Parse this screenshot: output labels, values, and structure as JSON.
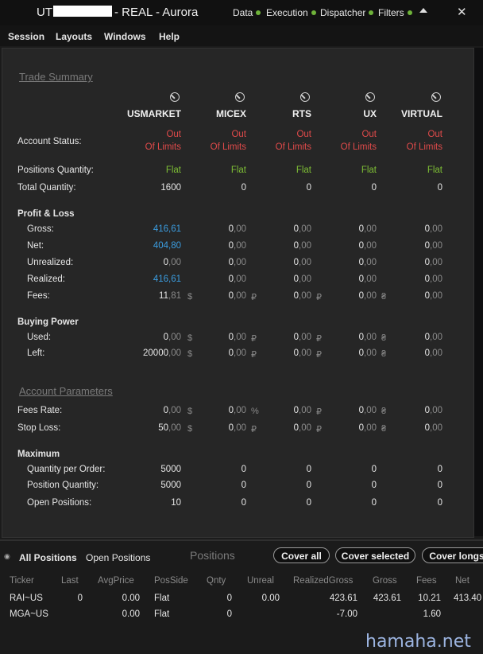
{
  "window": {
    "title_prefix": "UT",
    "title_suffix": "- REAL - Aurora",
    "nav": [
      "Data",
      "Execution",
      "Dispatcher",
      "Filters"
    ],
    "close_glyph": "✕"
  },
  "menu": [
    "Session",
    "Layouts",
    "Windows",
    "Help"
  ],
  "trade_summary": {
    "section_title": "Trade Summary",
    "columns": [
      "USMARKET",
      "MICEX",
      "RTS",
      "UX",
      "VIRTUAL"
    ],
    "labels": {
      "account_status": "Account Status:",
      "positions_quantity": "Positions Quantity:",
      "total_quantity": "Total Quantity:",
      "profit_loss": "Profit & Loss",
      "gross": "Gross:",
      "net": "Net:",
      "unrealized": "Unrealized:",
      "realized": "Realized:",
      "fees": "Fees:",
      "buying_power": "Buying Power",
      "used": "Used:",
      "left": "Left:"
    },
    "account_status": [
      [
        "Out",
        "Of Limits"
      ],
      [
        "Out",
        "Of Limits"
      ],
      [
        "Out",
        "Of Limits"
      ],
      [
        "Out",
        "Of Limits"
      ],
      [
        "Out",
        "Of Limits"
      ]
    ],
    "positions_quantity": [
      "Flat",
      "Flat",
      "Flat",
      "Flat",
      "Flat"
    ],
    "total_quantity": [
      "1600",
      "0",
      "0",
      "0",
      "0"
    ],
    "gross": [
      [
        "416",
        ",61"
      ],
      [
        "0",
        ",00"
      ],
      [
        "0",
        ",00"
      ],
      [
        "0",
        ",00"
      ],
      [
        "0",
        ",00"
      ]
    ],
    "net": [
      [
        "404",
        ",80"
      ],
      [
        "0",
        ",00"
      ],
      [
        "0",
        ",00"
      ],
      [
        "0",
        ",00"
      ],
      [
        "0",
        ",00"
      ]
    ],
    "unrealized": [
      [
        "0",
        ",00"
      ],
      [
        "0",
        ",00"
      ],
      [
        "0",
        ",00"
      ],
      [
        "0",
        ",00"
      ],
      [
        "0",
        ",00"
      ]
    ],
    "realized": [
      [
        "416",
        ",61"
      ],
      [
        "0",
        ",00"
      ],
      [
        "0",
        ",00"
      ],
      [
        "0",
        ",00"
      ],
      [
        "0",
        ",00"
      ]
    ],
    "fees": [
      [
        "11",
        ",81"
      ],
      [
        "0",
        ",00"
      ],
      [
        "0",
        ",00"
      ],
      [
        "0",
        ",00"
      ],
      [
        "0",
        ",00"
      ]
    ],
    "used": [
      [
        "0",
        ",00"
      ],
      [
        "0",
        ",00"
      ],
      [
        "0",
        ",00"
      ],
      [
        "0",
        ",00"
      ],
      [
        "0",
        ",00"
      ]
    ],
    "left": [
      [
        "20000",
        ",00"
      ],
      [
        "0",
        ",00"
      ],
      [
        "0",
        ",00"
      ],
      [
        "0",
        ",00"
      ],
      [
        "0",
        ",00"
      ]
    ],
    "currency": [
      "$",
      "₽",
      "₽",
      "₴"
    ]
  },
  "account_parameters": {
    "section_title": "Account Parameters",
    "labels": {
      "fees_rate": "Fees Rate:",
      "stop_loss": "Stop Loss:",
      "maximum": "Maximum",
      "quantity_per_order": "Quantity per Order:",
      "position_quantity": "Position Quantity:",
      "open_positions": "Open Positions:"
    },
    "fees_rate": [
      [
        "0",
        ",00"
      ],
      [
        "0",
        ",00"
      ],
      [
        "0",
        ",00"
      ],
      [
        "0",
        ",00"
      ],
      [
        "0",
        ",00"
      ]
    ],
    "fees_rate_units": [
      "$",
      "%",
      "₽",
      "₴"
    ],
    "stop_loss": [
      [
        "50",
        ",00"
      ],
      [
        "0",
        ",00"
      ],
      [
        "0",
        ",00"
      ],
      [
        "0",
        ",00"
      ],
      [
        "0",
        ",00"
      ]
    ],
    "quantity_per_order": [
      "5000",
      "0",
      "0",
      "0",
      "0"
    ],
    "position_quantity": [
      "5000",
      "0",
      "0",
      "0",
      "0"
    ],
    "open_positions": [
      "10",
      "0",
      "0",
      "0",
      "0"
    ]
  },
  "positions": {
    "tabs": [
      "All Positions",
      "Open Positions"
    ],
    "title": "Positions",
    "buttons": [
      "Cover all",
      "Cover selected",
      "Cover longs"
    ],
    "headers": [
      "Ticker",
      "Last",
      "AvgPrice",
      "PosSide",
      "Qnty",
      "Unreal",
      "RealizedGross",
      "Gross",
      "Fees",
      "Net"
    ],
    "rows": [
      {
        "ticker": "RAI~US",
        "last": "0",
        "avg": "0.00",
        "side": "Flat",
        "qnty": "0",
        "unreal": "0.00",
        "realized": "423.61",
        "gross": "423.61",
        "fees": "10.21",
        "net": "413.40"
      },
      {
        "ticker": "MGA~US",
        "last": "",
        "avg": "0.00",
        "side": "Flat",
        "qnty": "0",
        "unreal": "",
        "realized": "-7.00",
        "gross": "",
        "fees": "1.60",
        "net": ""
      }
    ]
  },
  "watermark": "hamaha.net"
}
